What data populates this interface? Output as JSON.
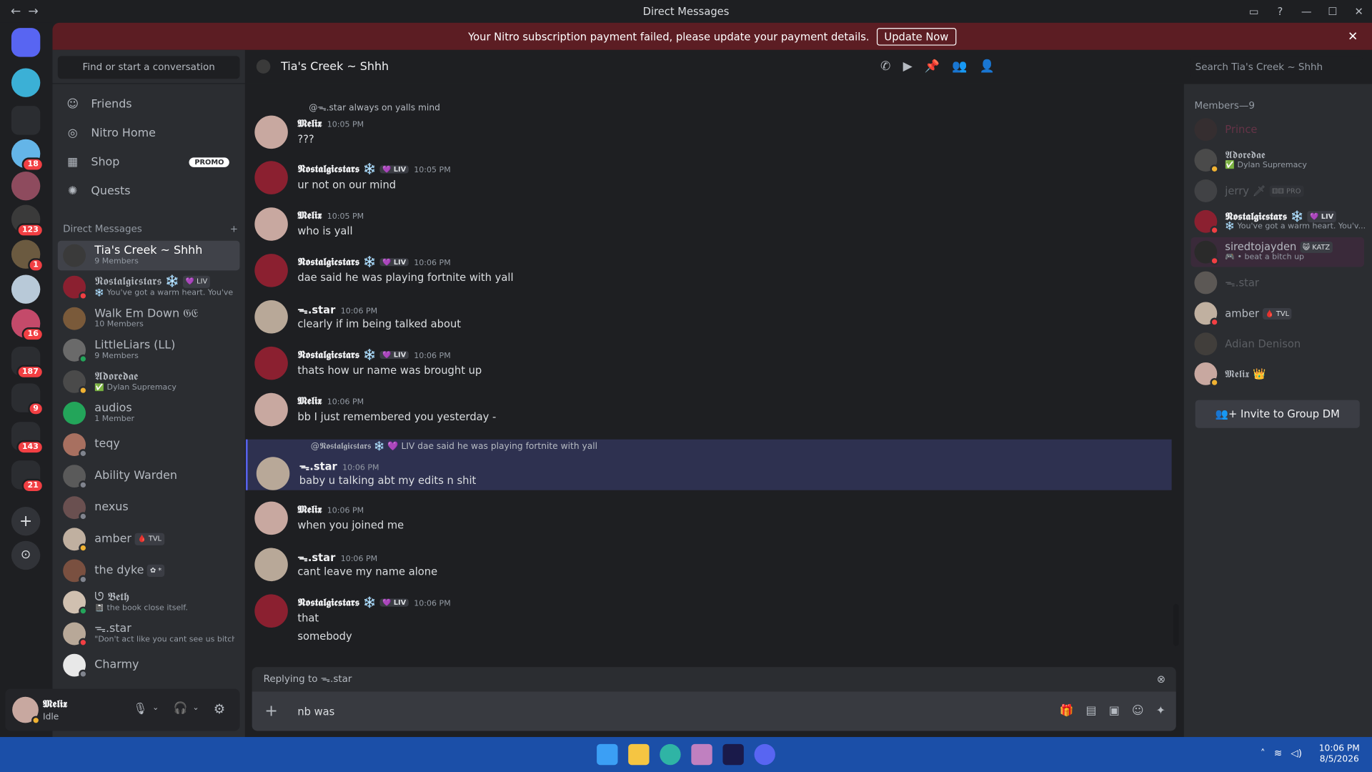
{
  "window": {
    "title": "Direct Messages",
    "back": "←",
    "forward": "→",
    "minimize": "—",
    "maximize": "☐",
    "close": "✕"
  },
  "banner": {
    "text": "Your Nitro subscription payment failed, please update your payment details.",
    "button": "Update Now",
    "close": "✕"
  },
  "servers": {
    "badges": [
      "18",
      "123",
      "1",
      "16",
      "187",
      "9",
      "143",
      "21"
    ]
  },
  "sidebar": {
    "find": "Find or start a conversation",
    "nav": [
      {
        "label": "Friends",
        "icon": "friends-icon"
      },
      {
        "label": "Nitro Home",
        "icon": "nitro-icon"
      },
      {
        "label": "Shop",
        "icon": "shop-icon",
        "badge": "PROMO"
      },
      {
        "label": "Quests",
        "icon": "quests-icon"
      }
    ],
    "dm_header": "Direct Messages",
    "dm_add": "+",
    "dms": [
      {
        "name": "Tia's Creek ~ Shhh",
        "sub": "9 Members"
      },
      {
        "name": "𝕹𝖔𝖘𝖙𝖆𝖑𝖌𝖎𝖈𝖘𝖙𝖆𝖗𝖘 ❄️",
        "tag": "💜 LIV",
        "sub": "❄️ You've got a warm heart. You've ..."
      },
      {
        "name": "Walk Em Down 𝔊𝔈",
        "sub": "10 Members"
      },
      {
        "name": "LittleLiars (LL)",
        "sub": "9 Members"
      },
      {
        "name": "𝕬𝖉𝖔𝖗𝖊𝖉𝖆𝖊",
        "sub": "✅ Dylan Supremacy"
      },
      {
        "name": "audios",
        "sub": "1 Member"
      },
      {
        "name": "teqy",
        "sub": ""
      },
      {
        "name": "Ability Warden",
        "sub": ""
      },
      {
        "name": "nexus",
        "sub": ""
      },
      {
        "name": "amber",
        "tag": "🩸 TVL",
        "sub": ""
      },
      {
        "name": "the dyke",
        "tag": "✿ *",
        "sub": ""
      },
      {
        "name": "ᘎ 𝕭𝖊𝖙𝖍",
        "sub": "📓 the book close itself."
      },
      {
        "name": "ᯓ.star",
        "sub": "\"Don't act like you cant see us bitch\""
      },
      {
        "name": "Charmy",
        "sub": ""
      }
    ]
  },
  "user": {
    "name": "𝕸𝖊𝖑𝖎𝖝",
    "status": "Idle"
  },
  "chat": {
    "title": "Tia's Creek ~ Shhh",
    "search_placeholder": "Search Tia's Creek ~ Shhh"
  },
  "messages": [
    {
      "reply_to": "@ᯓ.star always on yalls mind",
      "author": "𝕸𝖊𝖑𝖎𝖝",
      "time": "10:05 PM",
      "text": "???"
    },
    {
      "author": "𝕹𝖔𝖘𝖙𝖆𝖑𝖌𝖎𝖈𝖘𝖙𝖆𝖗𝖘 ❄️",
      "tag": "💜 LIV",
      "time": "10:05 PM",
      "text": "ur not on our mind"
    },
    {
      "author": "𝕸𝖊𝖑𝖎𝖝",
      "time": "10:05 PM",
      "text": "who is yall"
    },
    {
      "author": "𝕹𝖔𝖘𝖙𝖆𝖑𝖌𝖎𝖈𝖘𝖙𝖆𝖗𝖘 ❄️",
      "tag": "💜 LIV",
      "time": "10:06 PM",
      "text": "dae said he was playing fortnite with yall"
    },
    {
      "author": "ᯓ.star",
      "time": "10:06 PM",
      "text": "clearly if im being talked about"
    },
    {
      "author": "𝕹𝖔𝖘𝖙𝖆𝖑𝖌𝖎𝖈𝖘𝖙𝖆𝖗𝖘 ❄️",
      "tag": "💜 LIV",
      "time": "10:06 PM",
      "text": "thats how ur name was brought up"
    },
    {
      "author": "𝕸𝖊𝖑𝖎𝖝",
      "time": "10:06 PM",
      "text": "bb I just remembered you yesterday -"
    },
    {
      "reply_to": "@𝕹𝖔𝖘𝖙𝖆𝖑𝖌𝖎𝖈𝖘𝖙𝖆𝖗𝖘 ❄️ 💜 LIV dae said he was playing fortnite with yall",
      "author": "ᯓ.star",
      "time": "10:06 PM",
      "text": "baby u talking abt my edits n shit"
    },
    {
      "author": "𝕸𝖊𝖑𝖎𝖝",
      "time": "10:06 PM",
      "text": "when you joined me"
    },
    {
      "author": "ᯓ.star",
      "time": "10:06 PM",
      "text": "cant leave my name alone"
    },
    {
      "author": "𝕹𝖔𝖘𝖙𝖆𝖑𝖌𝖎𝖈𝖘𝖙𝖆𝖗𝖘 ❄️",
      "tag": "💜 LIV",
      "time": "10:06 PM",
      "text": "that",
      "text2": "somebody"
    }
  ],
  "composer": {
    "replying": "Replying to ᯓ.star",
    "value": "nb was ",
    "plus": "+"
  },
  "members": {
    "header": "Members—9",
    "list": [
      {
        "name": "Prince",
        "sub": ""
      },
      {
        "name": "𝕬𝖉𝖔𝖗𝖊𝖉𝖆𝖊",
        "sub": "✅ Dylan Supremacy"
      },
      {
        "name": "jerry 🗡",
        "tag": "⚅⚅ PRO",
        "sub": ""
      },
      {
        "name": "𝕹𝖔𝖘𝖙𝖆𝖑𝖌𝖎𝖈𝖘𝖙𝖆𝖗𝖘 ❄️",
        "tag": "💜 LIV",
        "sub": "❄️ You've got a warm heart. You'v..."
      },
      {
        "name": "siredtojayden",
        "tag": "😺 KATZ",
        "sub": "🎮 • beat a bitch up"
      },
      {
        "name": "ᯓ.star",
        "sub": ""
      },
      {
        "name": "amber",
        "tag": "🩸 TVL",
        "sub": ""
      },
      {
        "name": "Adian Denison",
        "sub": ""
      },
      {
        "name": "𝕸𝖊𝖑𝖎𝖝 👑",
        "sub": ""
      }
    ],
    "invite": "Invite to Group DM"
  },
  "taskbar": {
    "time": "10:06 PM",
    "date": "8/5/2026"
  }
}
